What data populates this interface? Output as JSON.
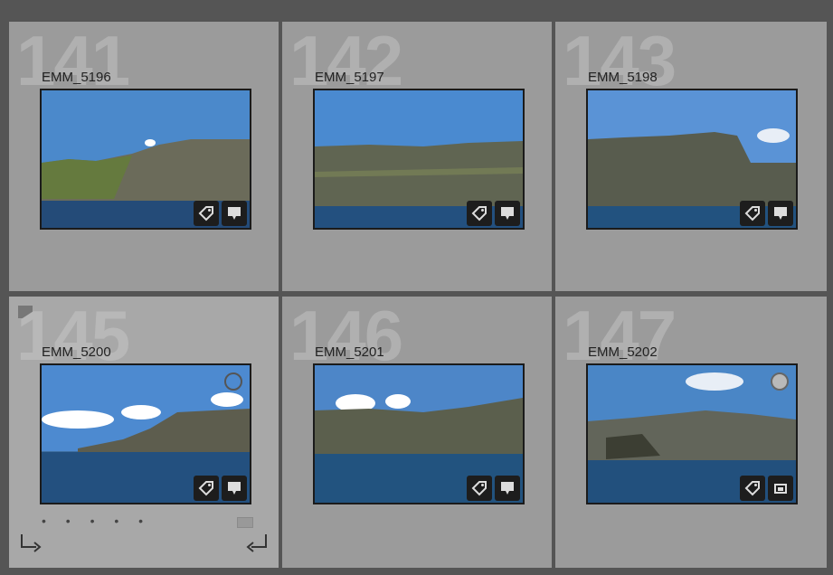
{
  "grid": {
    "cells": [
      {
        "index": "141",
        "filename": "EMM_5196",
        "sky": "#4b89cb",
        "cliff": "#6b6b5a",
        "sea": "#244b78"
      },
      {
        "index": "142",
        "filename": "EMM_5197",
        "sky": "#4a8ad0",
        "cliff": "#606552",
        "sea": "#23507f"
      },
      {
        "index": "143",
        "filename": "EMM_5198",
        "sky": "#5a93d6",
        "cliff": "#585c4e",
        "sea": "#22527f"
      },
      {
        "index": "145",
        "filename": "EMM_5200",
        "sky": "#4d8ad0",
        "cliff": "#5d5d4e",
        "sea": "#23507f"
      },
      {
        "index": "146",
        "filename": "EMM_5201",
        "sky": "#4d86c8",
        "cliff": "#5b5f4d",
        "sea": "#22537f"
      },
      {
        "index": "147",
        "filename": "EMM_5202",
        "sky": "#4a86c6",
        "cliff": "#62655a",
        "sea": "#22507d"
      }
    ]
  },
  "colors": {
    "cell_bg": "#9b9b9b",
    "cell_selected_bg": "#a8a8a8",
    "grid_line": "#555555",
    "badge_bg": "#1d1d1d"
  },
  "icons": {
    "keyword": "keyword-tag-icon",
    "comment": "comment-icon",
    "crop": "crop-icon",
    "flag": "flag-icon",
    "rotate_left": "rotate-left-icon",
    "rotate_right": "rotate-right-icon",
    "quick_collection": "quick-collection-circle-icon"
  },
  "selected_cell": {
    "rating_dots": "• • • • •"
  }
}
